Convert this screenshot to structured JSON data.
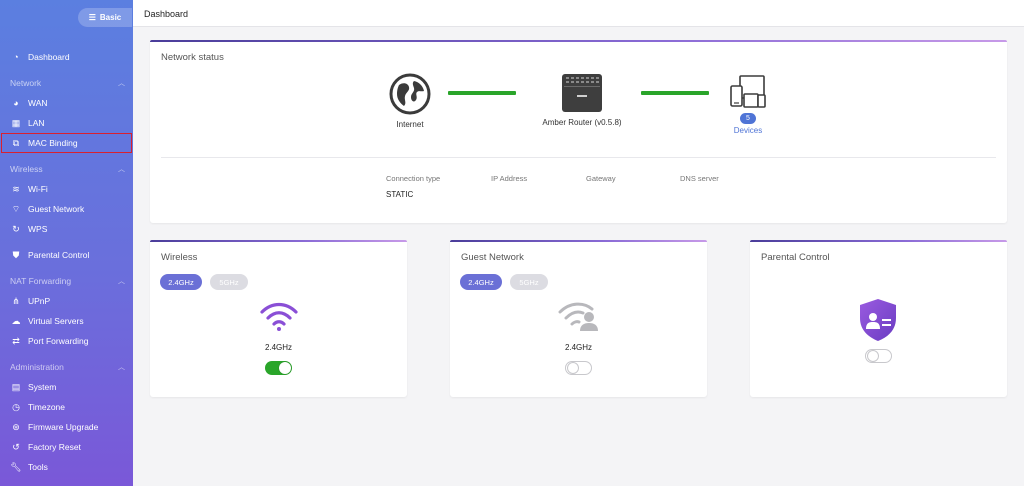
{
  "sidebar": {
    "mode_label": "Basic",
    "dashboard": "Dashboard",
    "sections": {
      "network": "Network",
      "wireless": "Wireless",
      "nat": "NAT Forwarding",
      "admin": "Administration"
    },
    "items": {
      "wan": "WAN",
      "lan": "LAN",
      "mac_binding": "MAC Binding",
      "wifi": "Wi-Fi",
      "guest_network": "Guest Network",
      "wps": "WPS",
      "parental_control": "Parental Control",
      "upnp": "UPnP",
      "virtual_servers": "Virtual Servers",
      "port_forwarding": "Port Forwarding",
      "system": "System",
      "timezone": "Timezone",
      "firmware_upgrade": "Firmware Upgrade",
      "factory_reset": "Factory Reset",
      "tools": "Tools"
    }
  },
  "topbar": {
    "breadcrumb": "Dashboard"
  },
  "network_status": {
    "title": "Network status",
    "internet_label": "Internet",
    "router_label": "Amber Router (v0.5.8)",
    "device_count": "5",
    "devices_label": "Devices",
    "connection_type_label": "Connection type",
    "ip_address_label": "IP Address",
    "gateway_label": "Gateway",
    "dns_server_label": "DNS server",
    "connection_type_value": "STATIC"
  },
  "wireless": {
    "title": "Wireless",
    "band_24": "2.4GHz",
    "band_5": "5GHz",
    "selected_band": "2.4GHz",
    "enabled": true
  },
  "guest_network": {
    "title": "Guest Network",
    "band_24": "2.4GHz",
    "band_5": "5GHz",
    "selected_band": "2.4GHz",
    "enabled": false
  },
  "parental_control": {
    "title": "Parental Control",
    "enabled": false
  },
  "colors": {
    "sidebar_top": "#5b7fe0",
    "sidebar_bottom": "#7a58d8",
    "link_green": "#2aa52a",
    "accent_purple": "#6b70d6",
    "highlight_red": "#d9202f"
  }
}
